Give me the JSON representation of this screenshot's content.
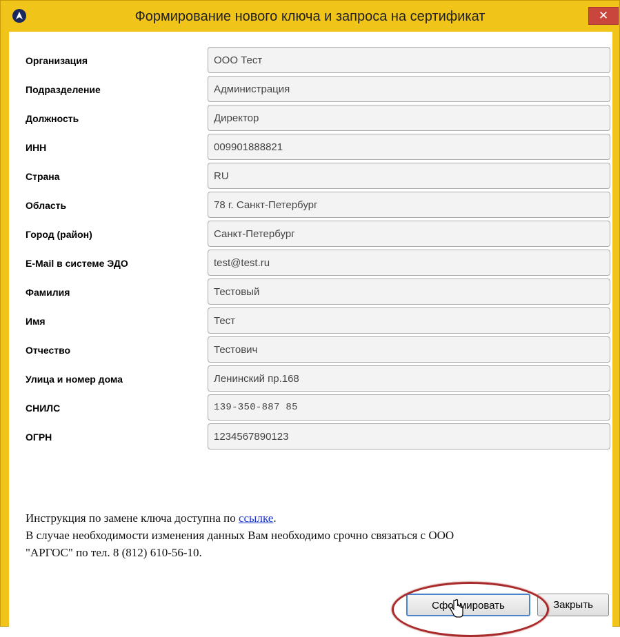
{
  "window": {
    "title": "Формирование нового ключа и запроса на сертификат",
    "close_label": "✕",
    "accent_color": "#f0c419",
    "close_color": "#c9463d"
  },
  "fields": [
    {
      "label": "Организация",
      "value": "ООО Тест"
    },
    {
      "label": "Подразделение",
      "value": "Администрация"
    },
    {
      "label": "Должность",
      "value": "Директор"
    },
    {
      "label": "ИНН",
      "value": "009901888821"
    },
    {
      "label": "Страна",
      "value": "RU"
    },
    {
      "label": "Область",
      "value": "78 г. Санкт-Петербург"
    },
    {
      "label": "Город (район)",
      "value": "Санкт-Петербург"
    },
    {
      "label": "E-Mail в системе ЭДО",
      "value": "test@test.ru"
    },
    {
      "label": "Фамилия",
      "value": "Тестовый"
    },
    {
      "label": "Имя",
      "value": "Тест"
    },
    {
      "label": "Отчество",
      "value": "Тестович"
    },
    {
      "label": "Улица и номер дома",
      "value": "Ленинский пр.168"
    },
    {
      "label": "СНИЛС",
      "value": "139-350-887 85"
    },
    {
      "label": "ОГРН",
      "value": "1234567890123"
    }
  ],
  "info": {
    "line1_prefix": "Инструкция по замене ключа доступна по ",
    "line1_link": "ссылке",
    "line1_suffix": ".",
    "line2": "В случае необходимости изменения данных Вам необходимо срочно связаться с ООО",
    "line3": "\"АРГОС\" по тел. 8 (812) 610-56-10."
  },
  "buttons": {
    "generate": "Сформировать",
    "close": "Закрыть"
  },
  "icons": {
    "app": "app-logo-icon",
    "close": "close-icon",
    "cursor": "hand-cursor-icon"
  }
}
